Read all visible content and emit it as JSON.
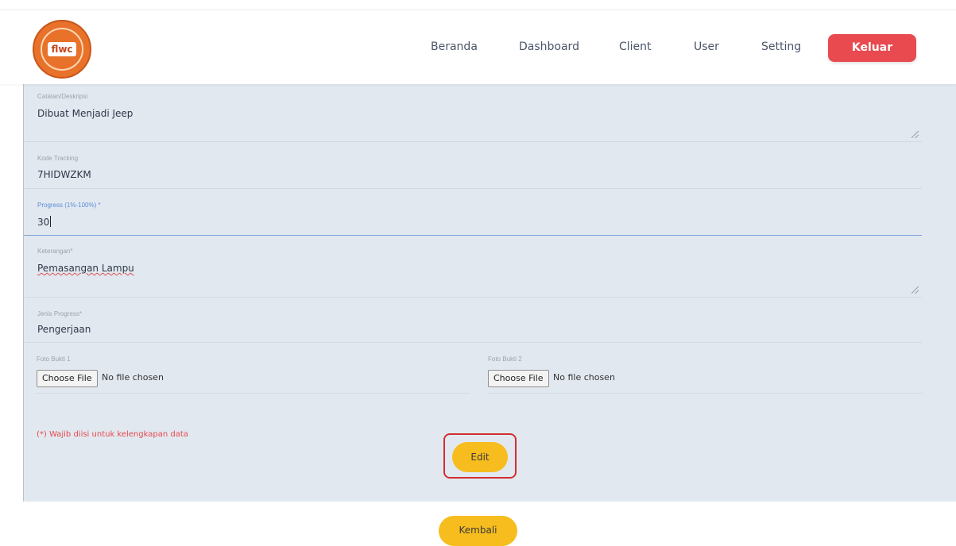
{
  "header": {
    "logo_text": "flwc",
    "nav": [
      "Beranda",
      "Dashboard",
      "Client",
      "User",
      "Setting"
    ],
    "logout_label": "Keluar"
  },
  "form": {
    "description": {
      "label": "Catatan/Deskripsi",
      "value": "Dibuat Menjadi Jeep"
    },
    "tracking_code": {
      "label": "Kode Tracking",
      "value": "7HIDWZKM"
    },
    "progress": {
      "label": "Progress (1%-100%) *",
      "value": "30"
    },
    "keterangan": {
      "label": "Keterangan*",
      "value": "Pemasangan Lampu"
    },
    "progress_type": {
      "label": "Jenis Progress*",
      "value": "Pengerjaan"
    },
    "photo1": {
      "label": "Foto Bukti 1",
      "button": "Choose File",
      "status": "No file chosen"
    },
    "photo2": {
      "label": "Foto Bukti 2",
      "button": "Choose File",
      "status": "No file chosen"
    },
    "required_note": "(*) Wajib diisi untuk kelengkapan data",
    "edit_label": "Edit"
  },
  "footer": {
    "back_label": "Kembali"
  },
  "colors": {
    "accent_yellow": "#f7bd1e",
    "logout_red": "#e84a4f",
    "panel_bg": "#e2e8f0"
  }
}
